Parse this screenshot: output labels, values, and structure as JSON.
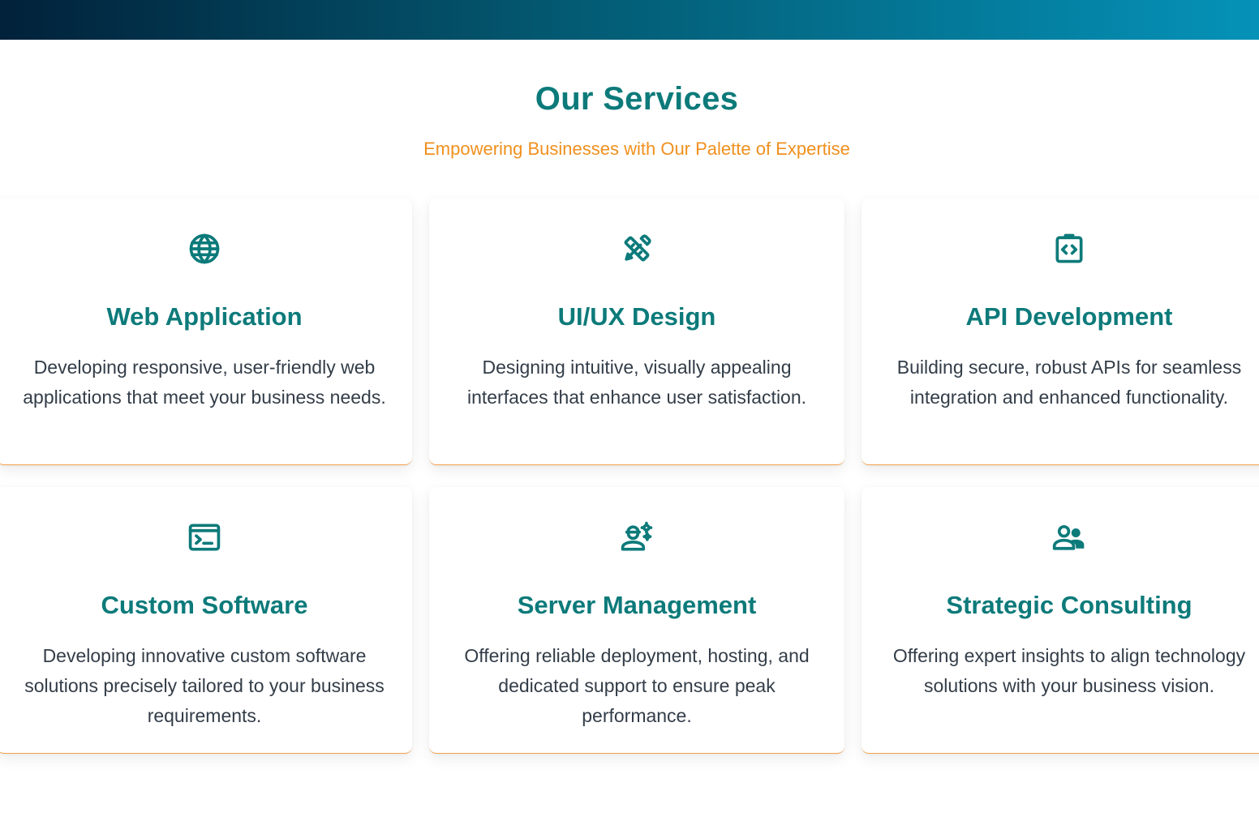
{
  "section": {
    "title": "Our Services",
    "subtitle": "Empowering Businesses with Our Palette of Expertise"
  },
  "colors": {
    "accent_teal": "#0d7a7a",
    "accent_orange": "#f0901e",
    "text_body": "#333d48"
  },
  "services": [
    {
      "icon": "globe-icon",
      "title": "Web Application",
      "description": "Developing responsive, user-friendly web applications that meet your business needs."
    },
    {
      "icon": "design-tools-icon",
      "title": "UI/UX Design",
      "description": "Designing intuitive, visually appealing interfaces that enhance user satisfaction."
    },
    {
      "icon": "api-code-icon",
      "title": "API Development",
      "description": "Building secure, robust APIs for seamless integration and enhanced functionality."
    },
    {
      "icon": "terminal-icon",
      "title": "Custom Software",
      "description": "Developing innovative custom software solutions precisely tailored to your business requirements."
    },
    {
      "icon": "engineer-gear-icon",
      "title": "Server Management",
      "description": "Offering reliable deployment, hosting, and dedicated support to ensure peak performance."
    },
    {
      "icon": "people-icon",
      "title": "Strategic Consulting",
      "description": "Offering expert insights to align technology solutions with your business vision."
    }
  ]
}
